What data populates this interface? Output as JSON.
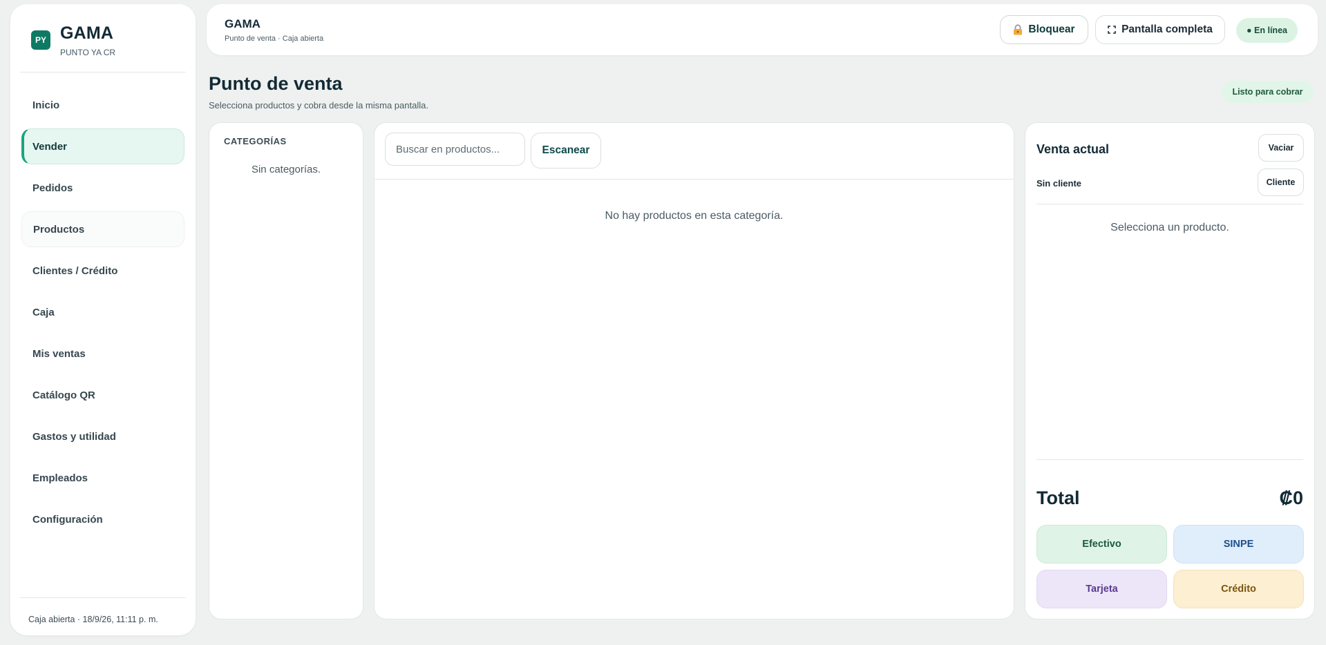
{
  "brand": {
    "logo_text": "PY",
    "name": "GAMA",
    "subtitle": "PUNTO YA CR"
  },
  "sidebar": {
    "items": [
      {
        "label": "Inicio"
      },
      {
        "label": "Vender"
      },
      {
        "label": "Pedidos"
      },
      {
        "label": "Productos"
      },
      {
        "label": "Clientes / Crédito"
      },
      {
        "label": "Caja"
      },
      {
        "label": "Mis ventas"
      },
      {
        "label": "Catálogo QR"
      },
      {
        "label": "Gastos y utilidad"
      },
      {
        "label": "Empleados"
      },
      {
        "label": "Configuración"
      }
    ],
    "active_item": "Vender",
    "footer": "Caja abierta · 18/9/26, 11:11 p. m."
  },
  "header": {
    "title": "GAMA",
    "subtitle": "Punto de venta · Caja abierta",
    "lock_label": "Bloquear",
    "fullscreen_label": "Pantalla completa",
    "status_label": "● En línea"
  },
  "page": {
    "title": "Punto de venta",
    "subtitle": "Selecciona productos y cobra desde la misma pantalla.",
    "ready_badge": "Listo para cobrar"
  },
  "categories": {
    "title": "CATEGORÍAS",
    "empty": "Sin categorías."
  },
  "products": {
    "search_placeholder": "Buscar en productos...",
    "scan_label": "Escanear",
    "empty": "No hay productos en esta categoría."
  },
  "sale": {
    "title": "Venta actual",
    "clear_label": "Vaciar",
    "client_text": "Sin cliente",
    "client_button": "Cliente",
    "empty": "Selecciona un producto.",
    "total_label": "Total",
    "total_value": "₡0",
    "payments": {
      "cash": "Efectivo",
      "sinpe": "SINPE",
      "card": "Tarjeta",
      "credit": "Crédito"
    }
  },
  "colors": {
    "accent": "#0f7a63",
    "active_nav_bg": "#e6f6f1",
    "online_badge_bg": "#dcf3e4",
    "cash_bg": "#dff3e7",
    "sinpe_bg": "#e0edfb",
    "card_bg": "#ece6f8",
    "credit_bg": "#fcefd2"
  },
  "icons": {
    "lock": "lock-icon",
    "fullscreen": "fullscreen-icon"
  }
}
